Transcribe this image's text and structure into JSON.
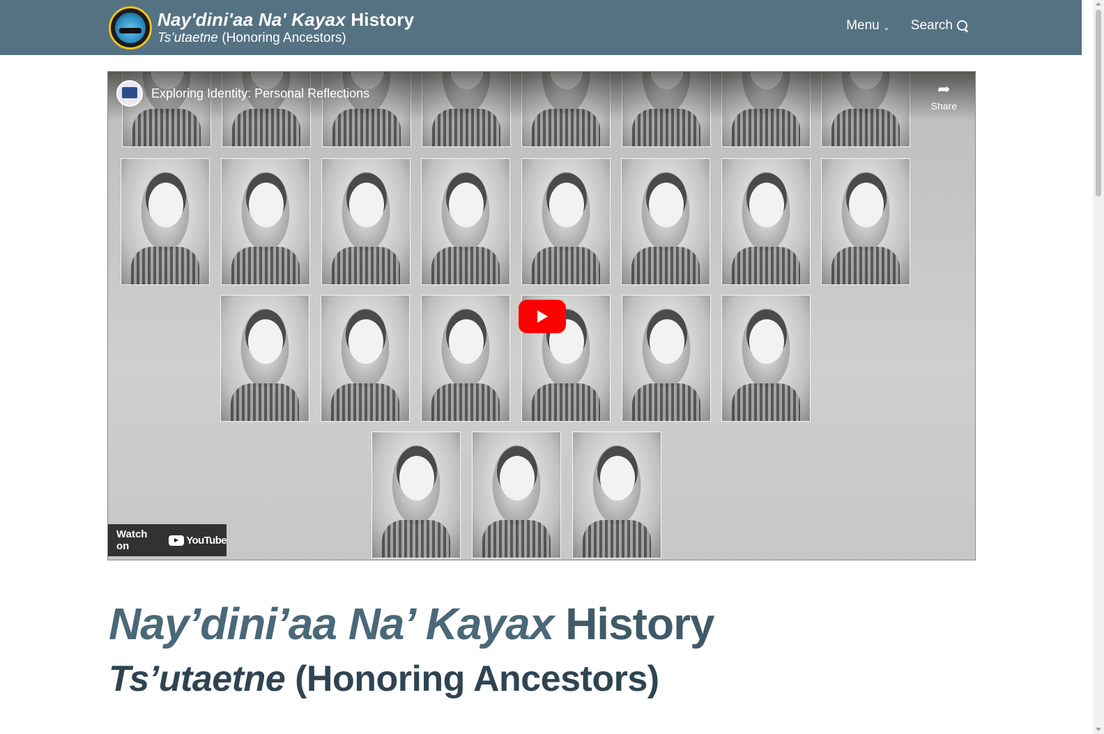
{
  "header": {
    "title_italic": "Nay'dini'aa Na' Kayax",
    "title_plain": "History",
    "subtitle_italic": "Ts’utaetne",
    "subtitle_plain": "(Honoring Ancestors)",
    "logo_icon": "tribal-seal-logo",
    "background_color": "#557282"
  },
  "nav": {
    "menu_label": "Menu",
    "menu_icon": "chevron-down-icon",
    "search_label": "Search",
    "search_icon": "search-icon"
  },
  "video": {
    "title": "Exploring Identity: Personal Reflections",
    "share_label": "Share",
    "share_icon": "share-arrow-icon",
    "watch_on_label": "Watch on",
    "youtube_label": "YouTube",
    "play_button_color": "#ff0000"
  },
  "main": {
    "heading_italic": "Nay’dini’aa Na’ Kayax",
    "heading_plain": "History",
    "subheading_italic": "Ts’utaetne",
    "subheading_plain": "(Honoring Ancestors)",
    "heading_color": "#4a6878"
  }
}
